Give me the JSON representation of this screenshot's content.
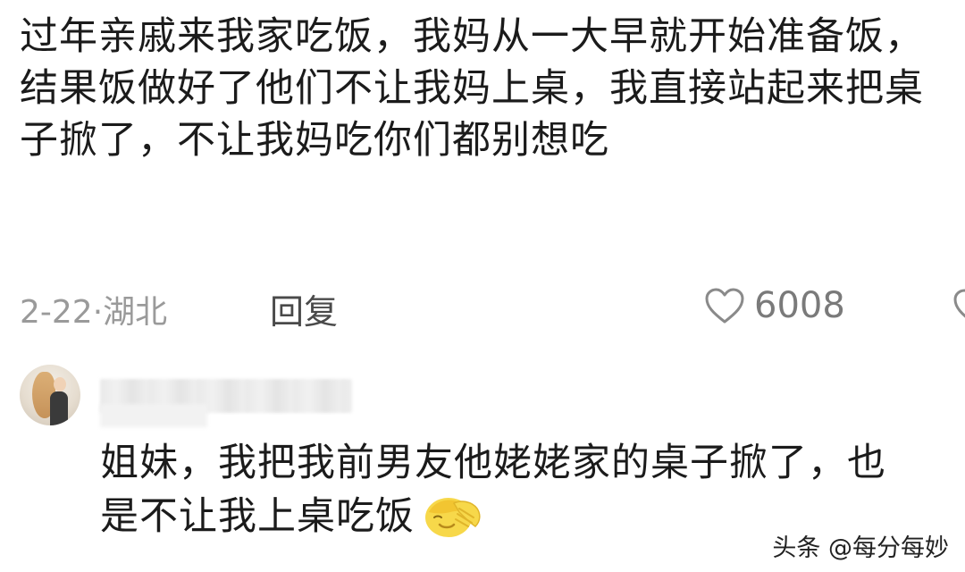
{
  "comment": {
    "text": "过年亲戚来我家吃饭，我妈从一大早就开始准备饭，结果饭做好了他们不让我妈上桌，我直接站起来把桌子掀了，不让我妈吃你们都别想吃",
    "meta": "2-22·湖北",
    "reply_label": "回复",
    "like_count": "6008",
    "icons": {
      "like": "heart-outline-icon",
      "dislike": "broken-heart-icon"
    }
  },
  "reply": {
    "text": "姐妹，我把我前男友他姥姥家的桌子掀了，也是不让我上桌吃饭",
    "emoji": "facepalm-emoji"
  },
  "watermark": {
    "text": "头条 @每分每妙"
  },
  "colors": {
    "text": "#1b1b1b",
    "meta": "#9a9a9a",
    "emoji_yellow": "#f7d84a"
  }
}
